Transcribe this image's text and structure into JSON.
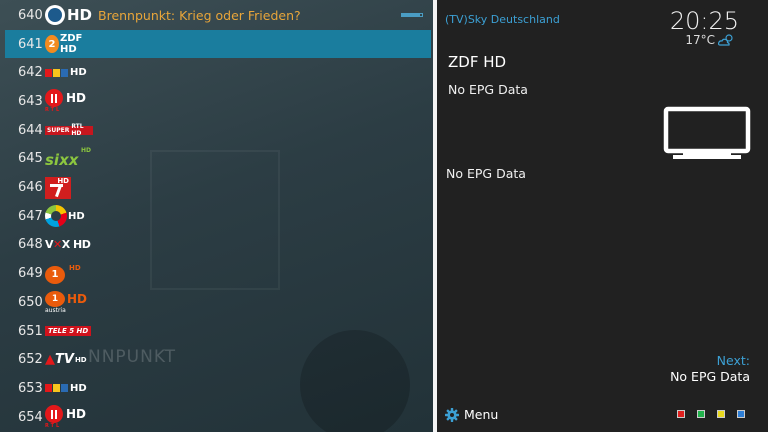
{
  "channels": [
    {
      "number": "640",
      "logo": "hd-channel-logo",
      "logo_text": "HD",
      "show": "Brennpunkt: Krieg oder Frieden?",
      "progress": 0.9,
      "selected": false
    },
    {
      "number": "641",
      "logo": "zdf-hd-logo",
      "logo_text": "ZDF HD",
      "selected": true
    },
    {
      "number": "642",
      "logo": "rtl-hd-logo",
      "logo_text": "RTL HD",
      "selected": false
    },
    {
      "number": "643",
      "logo": "rtl2-hd-logo",
      "logo_text": "HD",
      "selected": false
    },
    {
      "number": "644",
      "logo": "super-rtl-hd-logo",
      "logo_text": "SUPER RTL HD",
      "selected": false
    },
    {
      "number": "645",
      "logo": "sixx-hd-logo",
      "logo_text": "sixx",
      "selected": false
    },
    {
      "number": "646",
      "logo": "pro7-hd-logo",
      "logo_text": "HD",
      "selected": false
    },
    {
      "number": "647",
      "logo": "sat1-hd-logo",
      "logo_text": "HD",
      "selected": false
    },
    {
      "number": "648",
      "logo": "vox-hd-logo",
      "logo_text": "VOX HD",
      "selected": false
    },
    {
      "number": "649",
      "logo": "kabel1-hd-logo",
      "logo_text": "HD",
      "selected": false
    },
    {
      "number": "650",
      "logo": "kabel1-austria-hd-logo",
      "logo_text": "HD",
      "logo_subtext": "austria",
      "selected": false
    },
    {
      "number": "651",
      "logo": "tele5-hd-logo",
      "logo_text": "TELE 5 HD",
      "selected": false
    },
    {
      "number": "652",
      "logo": "atv-hd-logo",
      "logo_text": "ATV HD",
      "selected": false
    },
    {
      "number": "653",
      "logo": "rtl-hd-logo",
      "logo_text": "RTL HD",
      "selected": false
    },
    {
      "number": "654",
      "logo": "rtl2-hd-logo",
      "logo_text": "HD",
      "selected": false
    }
  ],
  "background_text": "NNPUNKT",
  "info": {
    "provider": "(TV)Sky Deutschland",
    "time": "20:25",
    "temperature": "17°C",
    "weather_icon": "cloudy-icon",
    "channel_name": "ZDF HD",
    "epg_now": "No EPG Data",
    "epg_description": "No EPG Data",
    "next_label": "Next:",
    "next_value": "No EPG Data",
    "menu_label": "Menu",
    "menu_icon": "gear-icon"
  },
  "color_buttons": [
    "#e0201e",
    "#22b24c",
    "#e8d81e",
    "#2f7fd6"
  ],
  "accent": "#1a7d9e"
}
